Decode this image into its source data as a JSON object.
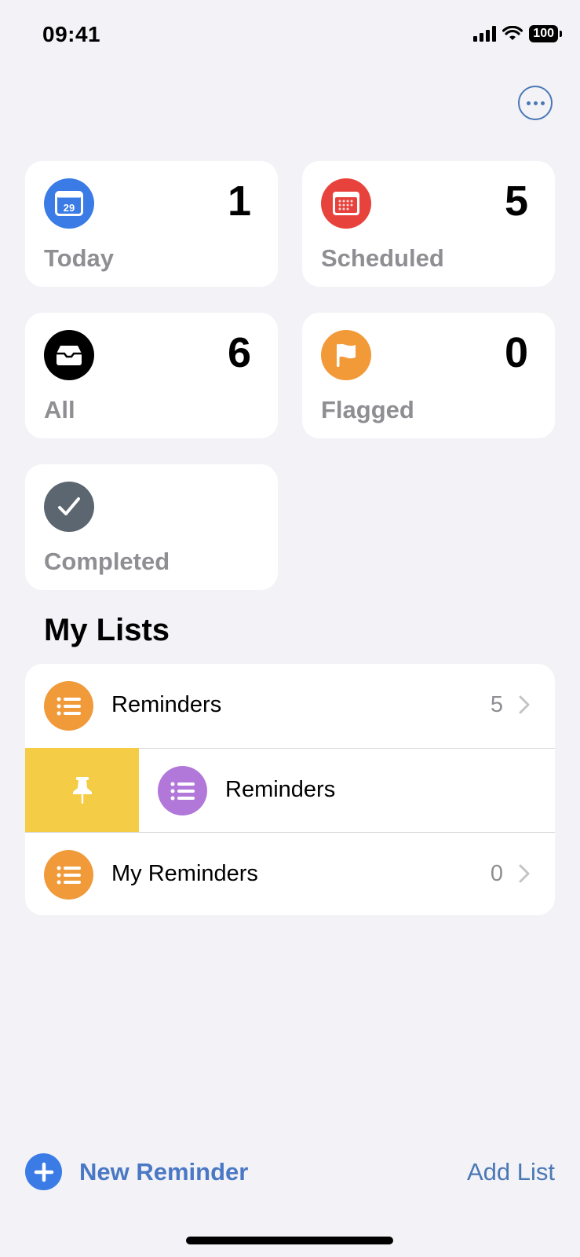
{
  "status_bar": {
    "time": "09:41",
    "battery": "100"
  },
  "header": {
    "more_button": "more-options"
  },
  "smart_lists": [
    {
      "id": "today",
      "label": "Today",
      "count": "1",
      "icon": "calendar-today-icon",
      "icon_text": "29",
      "color": "#3a7be6"
    },
    {
      "id": "scheduled",
      "label": "Scheduled",
      "count": "5",
      "icon": "calendar-grid-icon",
      "color": "#e8423c"
    },
    {
      "id": "all",
      "label": "All",
      "count": "6",
      "icon": "tray-icon",
      "color": "#000000"
    },
    {
      "id": "flagged",
      "label": "Flagged",
      "count": "0",
      "icon": "flag-icon",
      "color": "#f29a38"
    },
    {
      "id": "completed",
      "label": "Completed",
      "count": "",
      "icon": "checkmark-icon",
      "color": "#5b6670"
    }
  ],
  "my_lists": {
    "title": "My Lists",
    "items": [
      {
        "name": "Reminders",
        "count": "5",
        "color": "#f09a3a"
      },
      {
        "name": "Reminders",
        "count": "",
        "color": "#b278d9",
        "swiped": true,
        "swipe_action": "pin"
      },
      {
        "name": "My Reminders",
        "count": "0",
        "color": "#f09a3a"
      }
    ],
    "swipe_action_color": "#f5cc45"
  },
  "bottom_bar": {
    "new_reminder": "New Reminder",
    "add_list": "Add List",
    "accent": "#3a7be6"
  }
}
